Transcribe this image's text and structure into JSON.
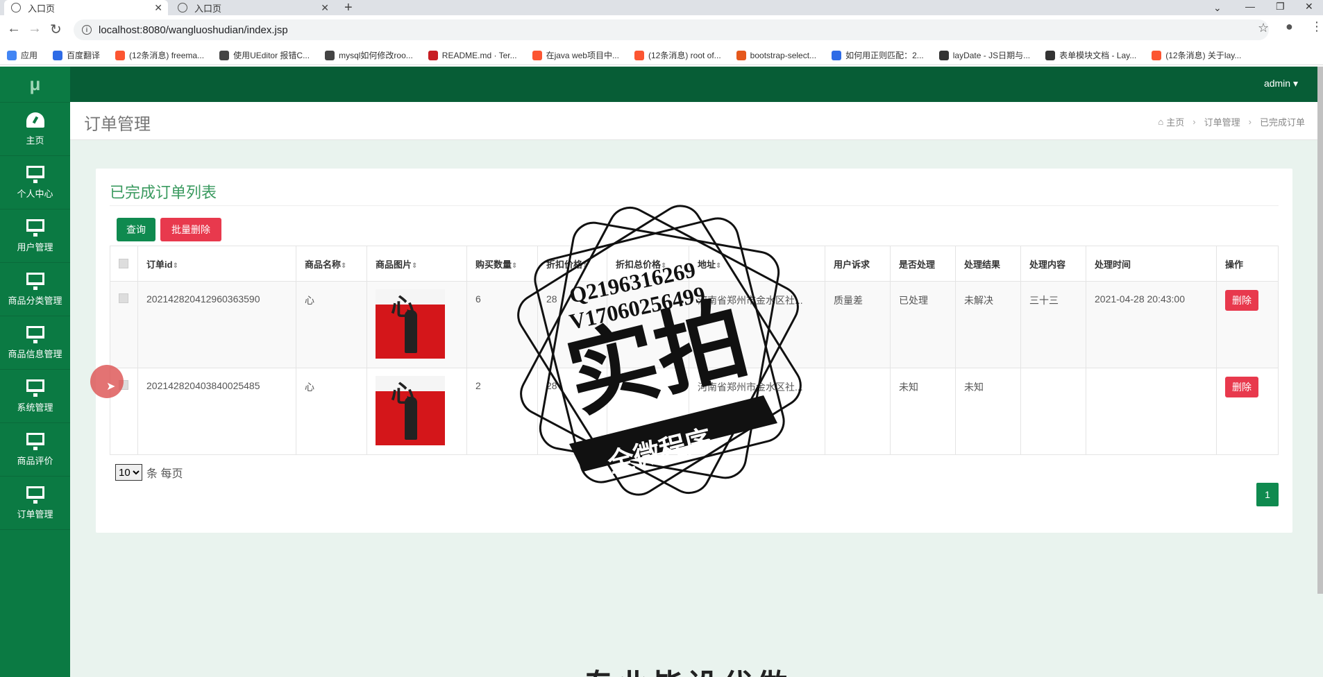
{
  "browser": {
    "tabs": [
      {
        "label": "入口页"
      },
      {
        "label": "入口页"
      }
    ],
    "new_tab": "+",
    "url": "localhost:8080/wangluoshudian/index.jsp",
    "bookmarks": [
      {
        "label": "应用",
        "color": "#4285f4"
      },
      {
        "label": "百度翻译",
        "color": "#2e6be6"
      },
      {
        "label": "(12条消息) freema...",
        "color": "#fc5531"
      },
      {
        "label": "使用UEditor 报错C...",
        "color": "#444444"
      },
      {
        "label": "mysql如何修改roo...",
        "color": "#444444"
      },
      {
        "label": "README.md · Ter...",
        "color": "#c71d23"
      },
      {
        "label": "在java web项目中...",
        "color": "#fc5531"
      },
      {
        "label": "(12条消息) root of...",
        "color": "#fc5531"
      },
      {
        "label": "bootstrap-select...",
        "color": "#e5581c"
      },
      {
        "label": "如何用正则匹配：2...",
        "color": "#2e6be6"
      },
      {
        "label": "layDate - JS日期与...",
        "color": "#333333"
      },
      {
        "label": "表单模块文档 - Lay...",
        "color": "#333333"
      },
      {
        "label": "(12条消息) 关于lay...",
        "color": "#fc5531"
      }
    ]
  },
  "app": {
    "logo": "μ",
    "user": "admin",
    "sidebar": [
      {
        "label": "主页",
        "icon": "dashboard-icon"
      },
      {
        "label": "个人中心",
        "icon": "monitor-icon"
      },
      {
        "label": "用户管理",
        "icon": "monitor-icon"
      },
      {
        "label": "商品分类管理",
        "icon": "monitor-icon"
      },
      {
        "label": "商品信息管理",
        "icon": "monitor-icon"
      },
      {
        "label": "系统管理",
        "icon": "monitor-icon"
      },
      {
        "label": "商品评价",
        "icon": "monitor-icon"
      },
      {
        "label": "订单管理",
        "icon": "monitor-icon"
      }
    ],
    "page_title": "订单管理",
    "breadcrumb": [
      "主页",
      "订单管理",
      "已完成订单"
    ],
    "panel_title": "已完成订单列表",
    "buttons": {
      "query": "查询",
      "batch_delete": "批量删除"
    },
    "table": {
      "headers": [
        "订单id",
        "商品名称",
        "商品图片",
        "购买数量",
        "折扣价格",
        "折扣总价格",
        "地址",
        "用户诉求",
        "是否处理",
        "处理结果",
        "处理内容",
        "处理时间",
        "操作"
      ],
      "rows": [
        {
          "order_id": "202142820412960363590",
          "name": "心",
          "qty": "6",
          "price": "28",
          "total": "",
          "address": "河南省郑州市金水区社...",
          "appeal": "质量差",
          "handled": "已处理",
          "result": "未解决",
          "content": "三十三",
          "time": "2021-04-28 20:43:00",
          "action": "删除"
        },
        {
          "order_id": "202142820403840025485",
          "name": "心",
          "qty": "2",
          "price": "28",
          "total": "",
          "address": "河南省郑州市金水区社...",
          "appeal": "",
          "handled": "未知",
          "result": "未知",
          "content": "",
          "time": "",
          "action": "删除"
        }
      ]
    },
    "pager": {
      "page_size": "10",
      "suffix": "条 每页",
      "current_page": "1"
    },
    "watermark": {
      "line1": "Q2196316269",
      "line2": "V17060256499",
      "big": "实拍",
      "banner": "全微程序"
    },
    "bottom_text": "专业毕设代做",
    "colors": {
      "sidebar": "#0b7a43",
      "topbar": "#075d36",
      "danger": "#e8394d",
      "primary": "#0f8a4f"
    }
  }
}
